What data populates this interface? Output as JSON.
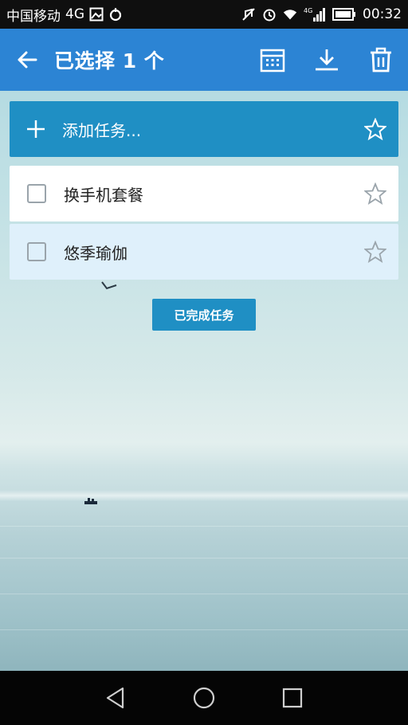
{
  "status_bar": {
    "carrier": "中国移动",
    "network": "4G",
    "signal_label": "4G",
    "time": "00:32",
    "icons": [
      "image-icon",
      "sync-icon",
      "mute-icon",
      "alarm-icon",
      "wifi-icon",
      "signal-icon",
      "battery-icon"
    ]
  },
  "app_bar": {
    "title": "已选择 1 个",
    "back_icon": "arrow-left-icon",
    "actions": [
      "calendar-icon",
      "download-icon",
      "trash-icon"
    ]
  },
  "add_task": {
    "label": "添加任务...",
    "icon": "plus-icon"
  },
  "tasks": [
    {
      "text": "换手机套餐",
      "checked": false,
      "starred": false,
      "selected": false
    },
    {
      "text": "悠季瑜伽",
      "checked": false,
      "starred": false,
      "selected": true
    }
  ],
  "completed_button": {
    "label": "已完成任务"
  },
  "nav_bar": {
    "buttons": [
      "back-triangle-icon",
      "home-circle-icon",
      "recents-square-icon"
    ]
  },
  "colors": {
    "app_bar": "#2c84d4",
    "accent": "#1f8fc4",
    "selected_row": "#dff0fb"
  }
}
